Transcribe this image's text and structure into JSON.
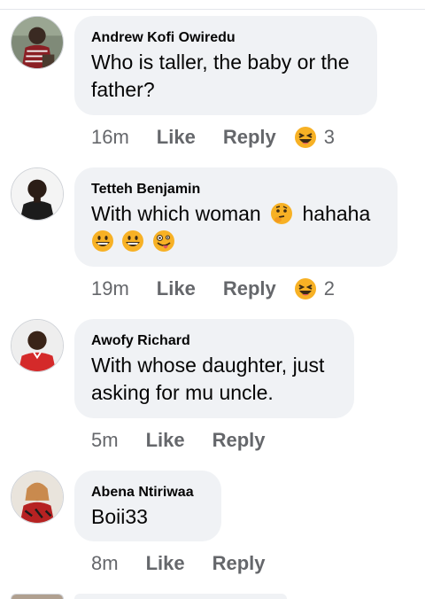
{
  "comments": [
    {
      "author": "Andrew Kofi Owiredu",
      "text": "Who is taller, the baby or the father?",
      "time": "16m",
      "like_label": "Like",
      "reply_label": "Reply",
      "reaction_icon": "laughing-emoji-icon",
      "reaction_count": "3"
    },
    {
      "author": "Tetteh Benjamin",
      "text_part1": "With which woman",
      "text_part2": "hahaha",
      "inline_emojis": [
        "thinking-face-emoji",
        "grinning-face-emoji",
        "grinning-face-emoji",
        "zany-face-emoji"
      ],
      "time": "19m",
      "like_label": "Like",
      "reply_label": "Reply",
      "reaction_icon": "laughing-emoji-icon",
      "reaction_count": "2"
    },
    {
      "author": "Awofy Richard",
      "text": "With whose daughter, just asking for mu uncle.",
      "time": "5m",
      "like_label": "Like",
      "reply_label": "Reply"
    },
    {
      "author": "Abena Ntiriwaa",
      "text": "Boii33",
      "time": "8m",
      "like_label": "Like",
      "reply_label": "Reply"
    }
  ],
  "colors": {
    "bubble": "#f0f2f5",
    "text": "#050505",
    "meta": "#65676b",
    "emoji_yellow": "#f7b125"
  }
}
